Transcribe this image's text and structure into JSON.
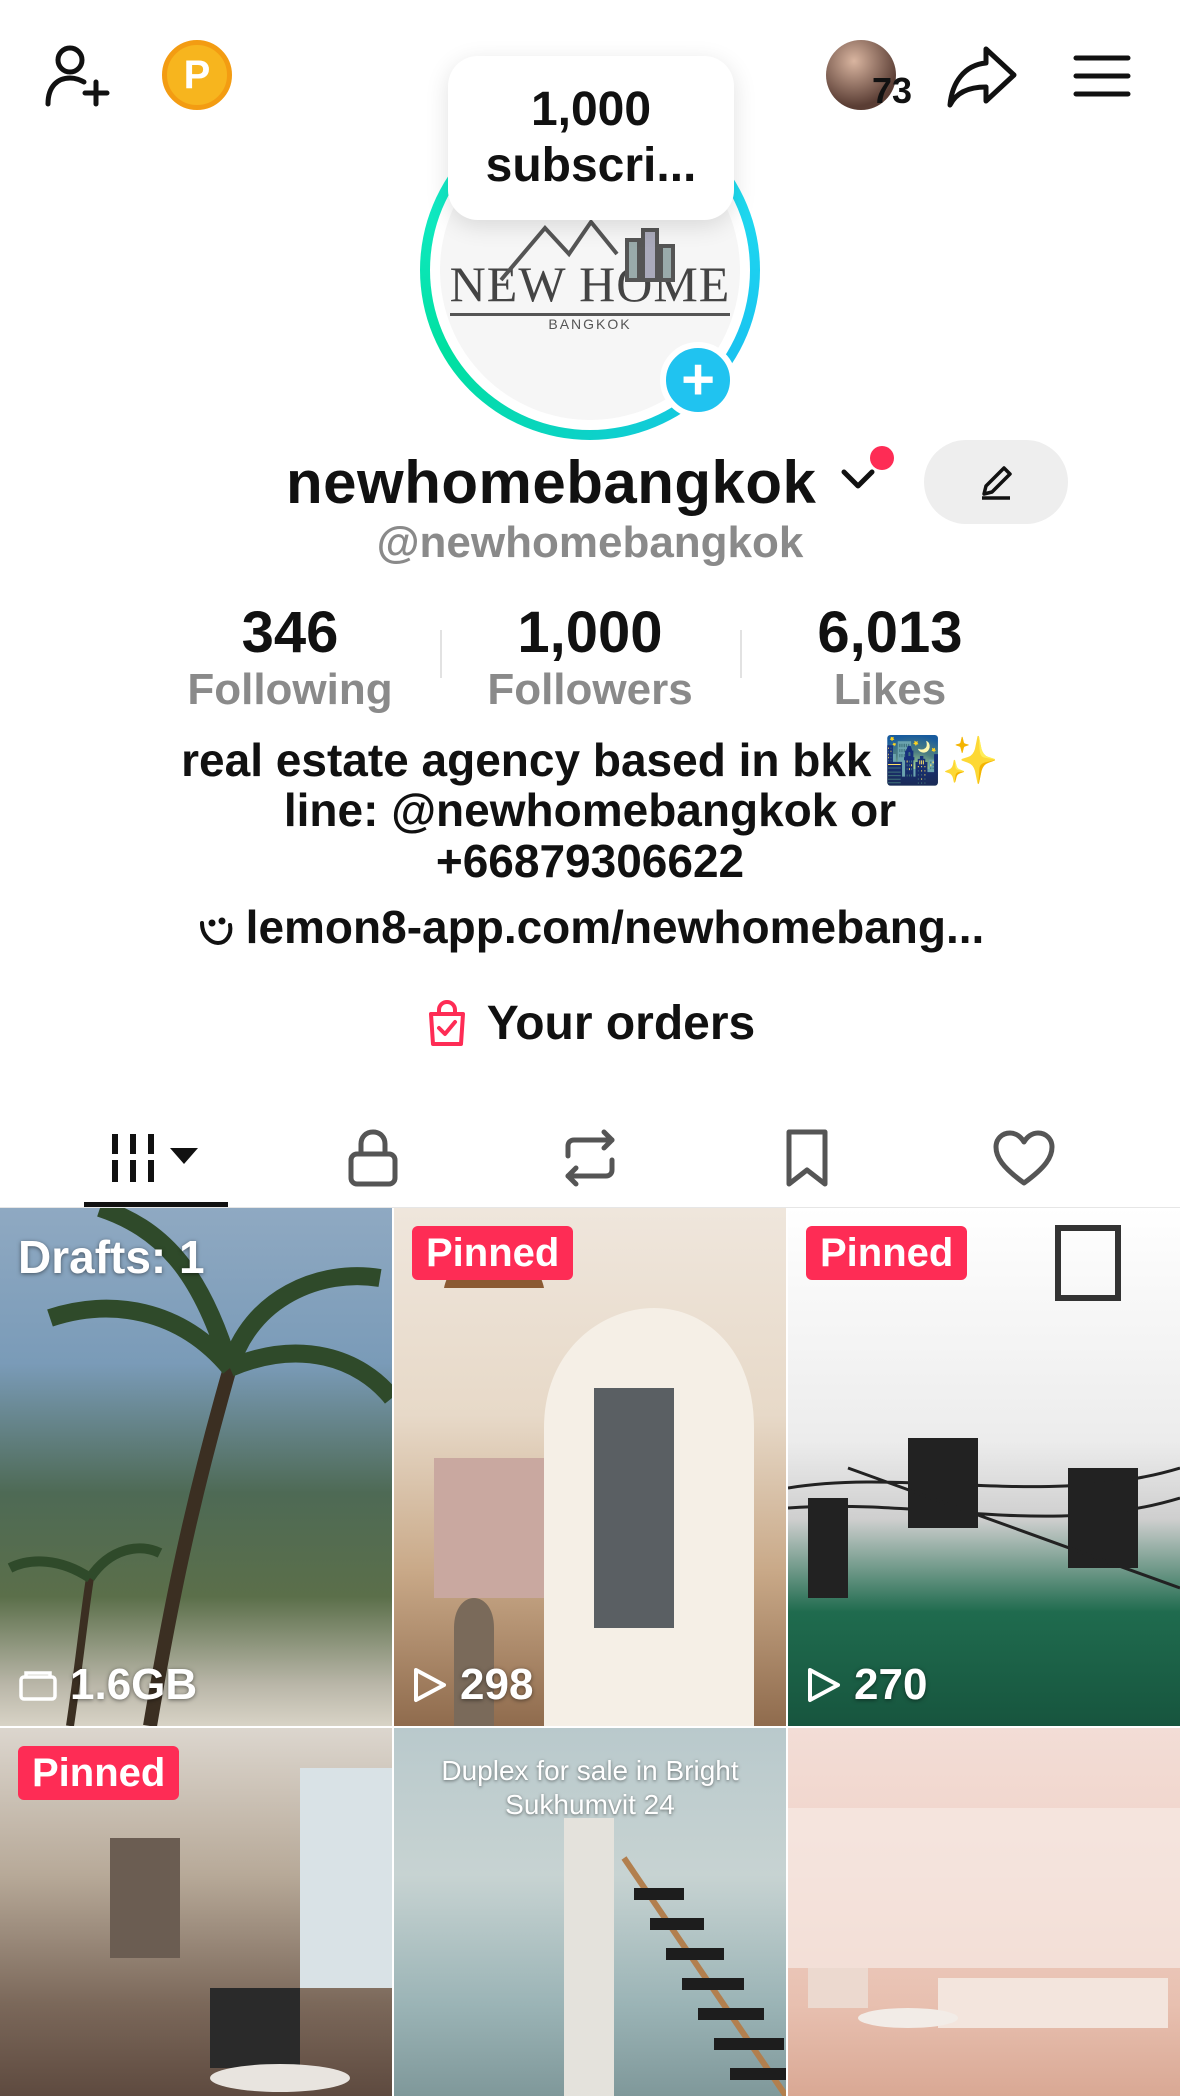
{
  "header": {
    "coin_letter": "P",
    "viewer_count": "73",
    "subscribe_bubble": {
      "line1": "1,000",
      "line2": "subscri..."
    }
  },
  "avatar": {
    "logo_main": "NEW HOME",
    "logo_sub": "BANGKOK"
  },
  "profile": {
    "name": "newhomebangkok",
    "handle": "@newhomebangkok"
  },
  "stats": [
    {
      "value": "346",
      "label": "Following"
    },
    {
      "value": "1,000",
      "label": "Followers"
    },
    {
      "value": "6,013",
      "label": "Likes"
    }
  ],
  "bio": {
    "line1": "real estate agency based in bkk 🌃✨",
    "line2": "line: @newhomebangkok or",
    "line3": "+66879306622",
    "link": "lemon8-app.com/newhomebang..."
  },
  "orders": {
    "label": "Your orders"
  },
  "tabs": [
    {
      "icon": "videos-grid-icon"
    },
    {
      "icon": "lock-icon"
    },
    {
      "icon": "repost-icon"
    },
    {
      "icon": "bookmark-icon"
    },
    {
      "icon": "heart-icon"
    }
  ],
  "grid": [
    {
      "overlay": "Drafts: 1",
      "stat": "1.6GB",
      "stat_icon": "folder-icon"
    },
    {
      "badge": "Pinned",
      "stat": "298",
      "stat_icon": "play-icon"
    },
    {
      "badge": "Pinned",
      "stat": "270",
      "stat_icon": "play-icon"
    },
    {
      "badge": "Pinned"
    },
    {
      "caption_line1": "Duplex for sale in Bright",
      "caption_line2": "Sukhumvit 24"
    },
    {}
  ],
  "colors": {
    "accent_red": "#fe2c55",
    "ring_cyan": "#25f4ee",
    "coin_gold": "#f7b51e",
    "muted_gray": "#8a8a8a"
  }
}
